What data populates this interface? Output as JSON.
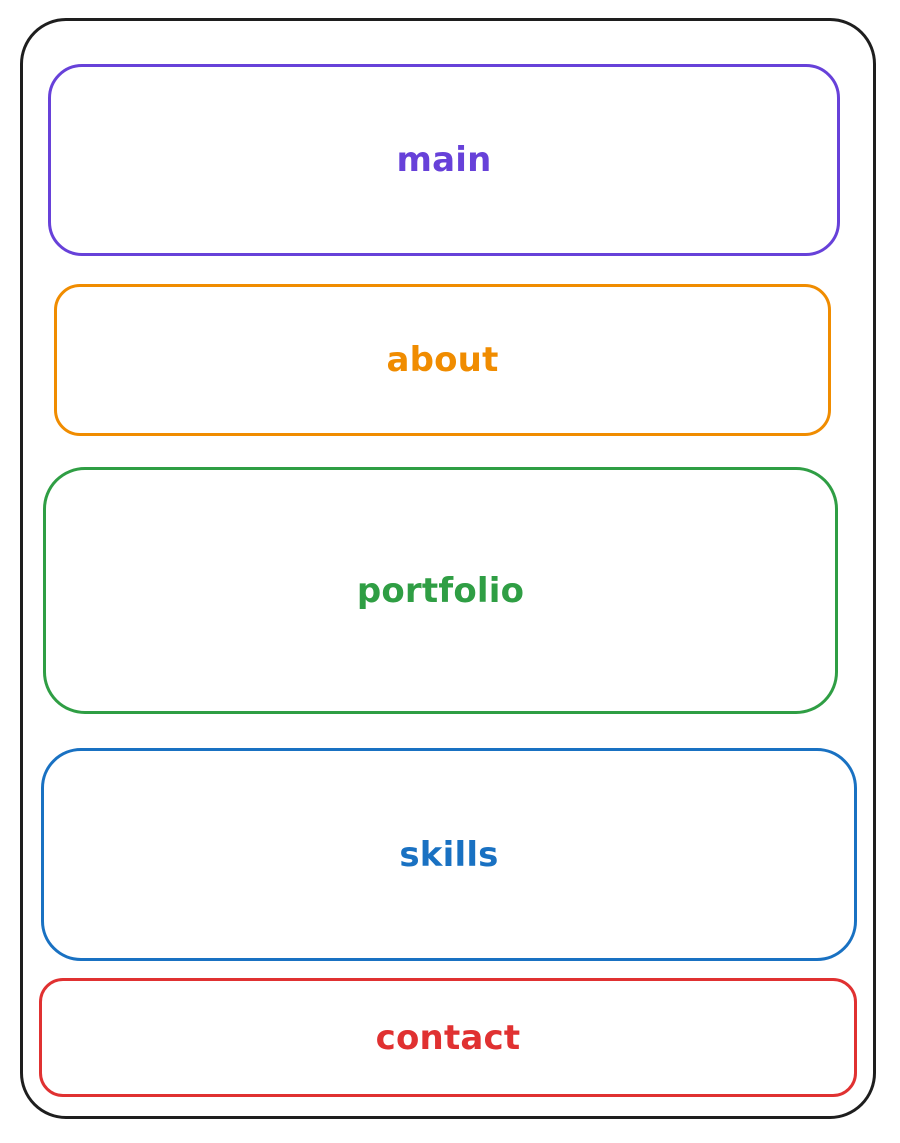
{
  "colors": {
    "frame": "#1e1e1e",
    "main": "#6741d9",
    "about": "#f08c00",
    "portfolio": "#2f9e44",
    "skills": "#1971c2",
    "contact": "#e03131"
  },
  "sections": {
    "main": "main",
    "about": "about",
    "portfolio": "portfolio",
    "skills": "skills",
    "contact": "contact"
  }
}
